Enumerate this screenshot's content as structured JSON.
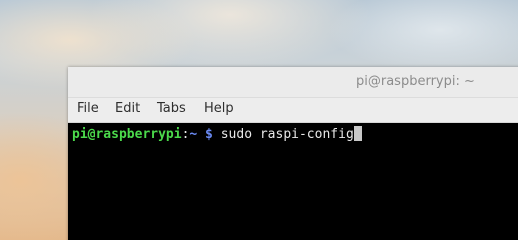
{
  "window": {
    "title": "pi@raspberrypi: ~"
  },
  "menubar": {
    "items": [
      "File",
      "Edit",
      "Tabs",
      "Help"
    ]
  },
  "terminal": {
    "user_host": "pi@raspberrypi",
    "separator": ":",
    "path": "~",
    "prompt_symbol": " $ ",
    "command": "sudo raspi-config",
    "colors": {
      "user_host": "#4bd94b",
      "path": "#6b8bf5",
      "background": "#000000"
    }
  }
}
